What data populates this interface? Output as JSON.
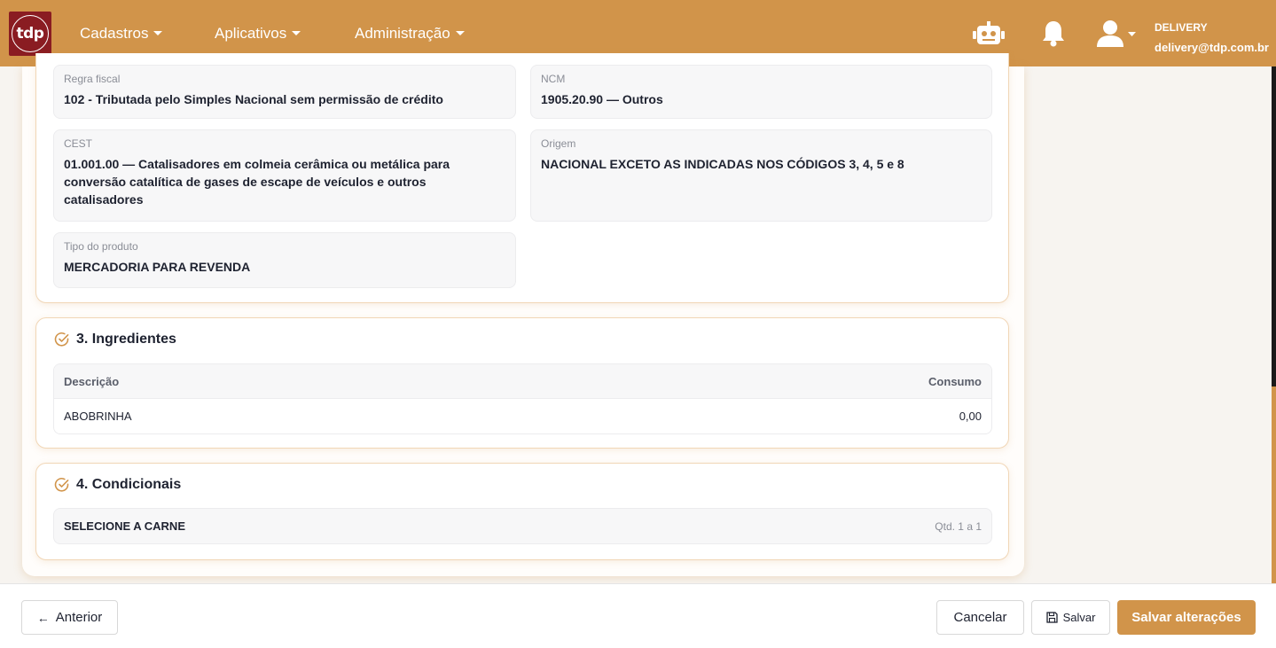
{
  "brand": {
    "logo_text": "tdp",
    "color": "#d1944a",
    "logo_bg": "#8a1c22"
  },
  "nav": {
    "menus": [
      {
        "label": "Cadastros"
      },
      {
        "label": "Aplicativos"
      },
      {
        "label": "Administração"
      }
    ],
    "icons": [
      "robot-icon",
      "bell-icon",
      "user-icon"
    ],
    "user": {
      "name": "DELIVERY",
      "email": "delivery@tdp.com.br"
    }
  },
  "fiscal": {
    "regra_fiscal": {
      "label": "Regra fiscal",
      "value": "102 - Tributada pelo Simples Nacional sem permissão de crédito"
    },
    "ncm": {
      "label": "NCM",
      "value": "1905.20.90 — Outros"
    },
    "cest": {
      "label": "CEST",
      "value": "01.001.00 — Catalisadores em colmeia cerâmica ou metálica para conversão catalítica de gases de escape de veículos e outros catalisadores"
    },
    "origem": {
      "label": "Origem",
      "value": "NACIONAL EXCETO AS INDICADAS NOS CÓDIGOS 3, 4, 5 e 8"
    },
    "tipo_produto": {
      "label": "Tipo do produto",
      "value": "MERCADORIA PARA REVENDA"
    }
  },
  "ingredientes": {
    "title": "3. Ingredientes",
    "columns": [
      "Descrição",
      "Consumo"
    ],
    "rows": [
      {
        "descricao": "ABOBRINHA",
        "consumo": "0,00"
      }
    ]
  },
  "condicionais": {
    "title": "4. Condicionais",
    "items": [
      {
        "label": "SELECIONE A CARNE",
        "qty": "Qtd. 1 a 1"
      }
    ]
  },
  "footer": {
    "anterior": "Anterior",
    "cancelar": "Cancelar",
    "salvar": "Salvar",
    "salvar_alteracoes": "Salvar alterações"
  }
}
